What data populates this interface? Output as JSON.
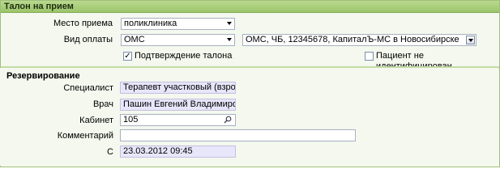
{
  "header": {
    "title": "Талон на прием"
  },
  "visit": {
    "place_label": "Место приема",
    "place_value": "поликлиника",
    "payment_label": "Вид оплаты",
    "payment_value": "ОМС",
    "policy_value": "ОМС, ЧБ, 12345678, КапиталЪ-МС в Новосибирске",
    "confirm_label": "Подтверждение талона",
    "confirm_checked": "✓",
    "unidentified_label": "Пациент не идентифицирован"
  },
  "reservation": {
    "title": "Резервирование",
    "specialist_label": "Специалист",
    "specialist_value": "Терапевт участковый (взрослый)",
    "doctor_label": "Врач",
    "doctor_value": "Пашин Евгений Владимирович",
    "cabinet_label": "Кабинет",
    "cabinet_value": "105",
    "comment_label": "Комментарий",
    "comment_value": "",
    "from_label": "С",
    "from_value": "23.03.2012 09:45"
  }
}
